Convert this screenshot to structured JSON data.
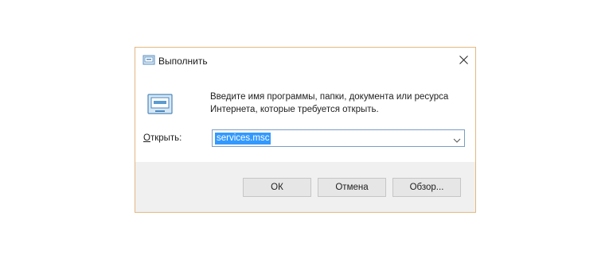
{
  "window": {
    "title": "Выполнить",
    "title_icon": "run-icon",
    "close_icon": "close-icon",
    "border_color": "#e3b980"
  },
  "content": {
    "icon": "run-icon",
    "description": "Введите имя программы, папки, документа или ресурса Интернета, которые требуется открыть.",
    "open_label_accel": "О",
    "open_label_rest": "ткрыть:",
    "open_input_value": "services.msc",
    "selection_color": "#3399ff"
  },
  "buttons": {
    "ok_label": "ОК",
    "cancel_label": "Отмена",
    "browse_label": "Обзор..."
  }
}
